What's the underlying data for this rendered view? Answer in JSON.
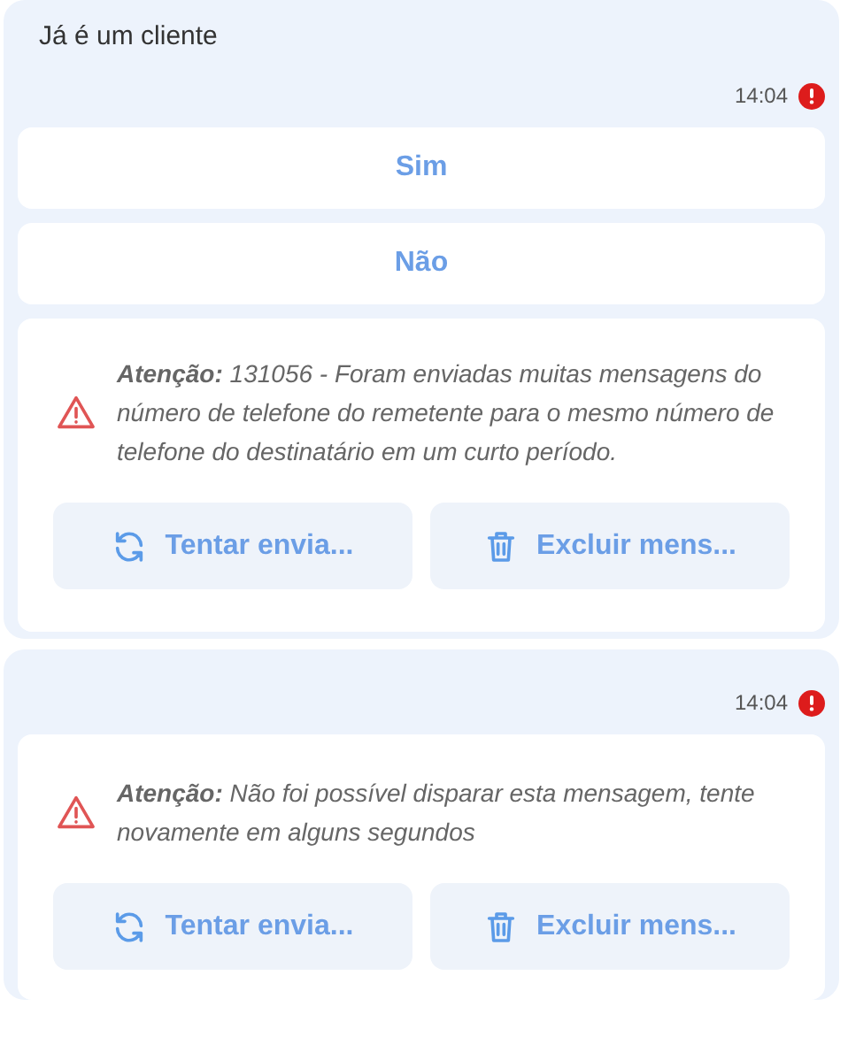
{
  "messages": [
    {
      "text": "Já é um cliente",
      "time": "14:04",
      "failed": true,
      "options": [
        "Sim",
        "Não"
      ],
      "alert": {
        "text": "**Atenção:** 131056 - Foram enviadas muitas mensagens do número de telefone do remetente para o mesmo número de telefone do destinatário em um curto período.",
        "actions": [
          {
            "kind": "retry",
            "label": "Tentar envia..."
          },
          {
            "kind": "delete",
            "label": "Excluir mens..."
          }
        ]
      }
    },
    {
      "time": "14:04",
      "failed": true,
      "alert": {
        "text": "**Atenção:** Não foi possível disparar esta mensagem, tente novamente em alguns segundos",
        "actions": [
          {
            "kind": "retry",
            "label": "Tentar envia..."
          },
          {
            "kind": "delete",
            "label": "Excluir mens..."
          }
        ]
      }
    }
  ]
}
